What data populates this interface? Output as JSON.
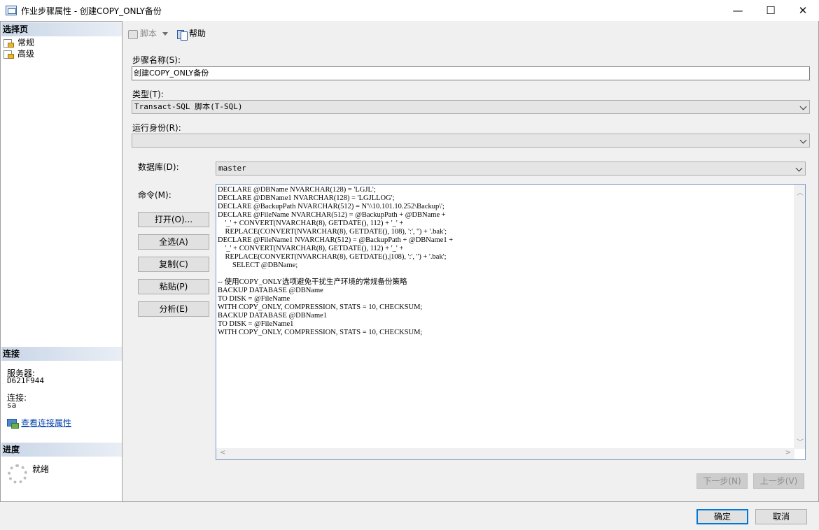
{
  "window": {
    "title": "作业步骤属性 - 创建COPY_ONLY备份",
    "minimize_glyph": "—",
    "maximize_glyph": "☐",
    "close_glyph": "✕"
  },
  "left": {
    "select_page_header": "选择页",
    "pages": [
      {
        "label": "常规",
        "icon": "page-settings-icon"
      },
      {
        "label": "高级",
        "icon": "page-settings-icon"
      }
    ],
    "connection_header": "连接",
    "server_label": "服务器:",
    "server_value": "D621F944",
    "connection_label": "连接:",
    "connection_value": "sa",
    "view_connection_link": "查看连接属性",
    "progress_header": "进度",
    "progress_status": "就绪"
  },
  "toolbar": {
    "script_label": "脚本",
    "help_label": "帮助"
  },
  "form": {
    "step_name_label": "步骤名称(S):",
    "step_name_value": "创建COPY_ONLY备份",
    "type_label": "类型(T):",
    "type_value": "Transact-SQL 脚本(T-SQL)",
    "run_as_label": "运行身份(R):",
    "run_as_value": "",
    "database_label": "数据库(D):",
    "database_value": "master",
    "command_label": "命令(M):",
    "command_text": "DECLARE @DBName NVARCHAR(128) = 'LGJL';\nDECLARE @DBName1 NVARCHAR(128) = 'LGJLLOG';\nDECLARE @BackupPath NVARCHAR(512) = N'\\\\10.101.10.252\\Backup\\';\nDECLARE @FileName NVARCHAR(512) = @BackupPath + @DBName +\n    '_' + CONVERT(NVARCHAR(8), GETDATE(), 112) + '_' +\n    REPLACE(CONVERT(NVARCHAR(8), GETDATE(), 108), ':', '') + '.bak';\nDECLARE @FileName1 NVARCHAR(512) = @BackupPath + @DBName1 +\n    '_' + CONVERT(NVARCHAR(8), GETDATE(), 112) + '_' +\n    REPLACE(CONVERT(NVARCHAR(8), GETDATE(),|108), ':', '') + '.bak';\n        SELECT @DBName;\n\n-- 使用COPY_ONLY选项避免干扰生产环境的常规备份策略\nBACKUP DATABASE @DBName\nTO DISK = @FileName\nWITH COPY_ONLY, COMPRESSION, STATS = 10, CHECKSUM;\nBACKUP DATABASE @DBName1\nTO DISK = @FileName1\nWITH COPY_ONLY, COMPRESSION, STATS = 10, CHECKSUM;",
    "buttons": {
      "open": "打开(O)...",
      "select_all": "全选(A)",
      "copy": "复制(C)",
      "paste": "粘贴(P)",
      "parse": "分析(E)"
    },
    "next_step": "下一步(N)",
    "prev_step": "上一步(V)"
  },
  "footer": {
    "ok": "确定",
    "cancel": "取消"
  },
  "colors": {
    "section_header": "#c9d6e7",
    "link": "#0645ad",
    "primary_border": "#0078d7"
  }
}
